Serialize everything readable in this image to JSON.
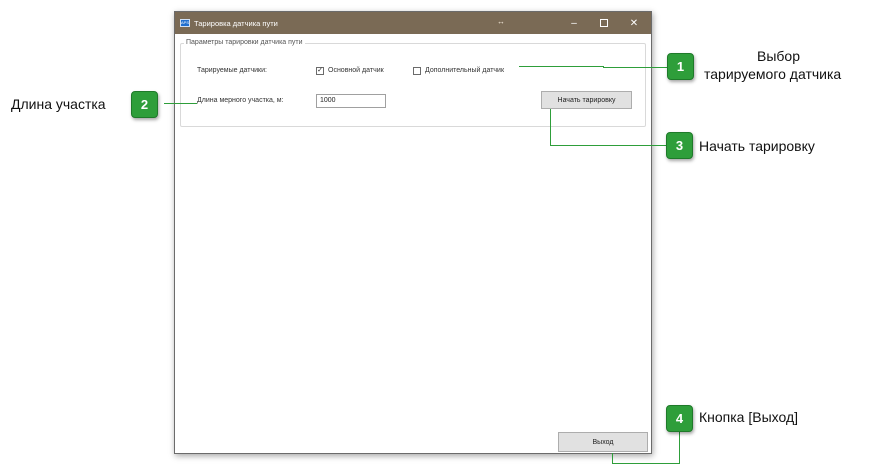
{
  "window": {
    "title": "Тарировка датчика пути",
    "app_icon_text": "APS",
    "controls": {
      "minimize": "–",
      "close": "✕",
      "resize": "↔"
    }
  },
  "group": {
    "legend": "Параметры тарировки датчика пути",
    "sensors_label": "Тарируемые датчики:",
    "main_sensor": {
      "label": "Основной датчик",
      "checked": true,
      "mark": "✓"
    },
    "extra_sensor": {
      "label": "Дополнительный датчик",
      "checked": false,
      "mark": ""
    },
    "length_label": "Длина мерного участка, м:",
    "length_value": "1000",
    "start_button": "Начать тарировку"
  },
  "exit_button": "Выход",
  "callouts": [
    {
      "number": "1",
      "line1": "Выбор",
      "line2": "тарируемого датчика"
    },
    {
      "number": "2",
      "text": "Длина участка"
    },
    {
      "number": "3",
      "text": "Начать тарировку"
    },
    {
      "number": "4",
      "text": "Кнопка [Выход]"
    }
  ],
  "colors": {
    "titlebar": "#7a6a55",
    "callout_green": "#2e9e3a"
  }
}
